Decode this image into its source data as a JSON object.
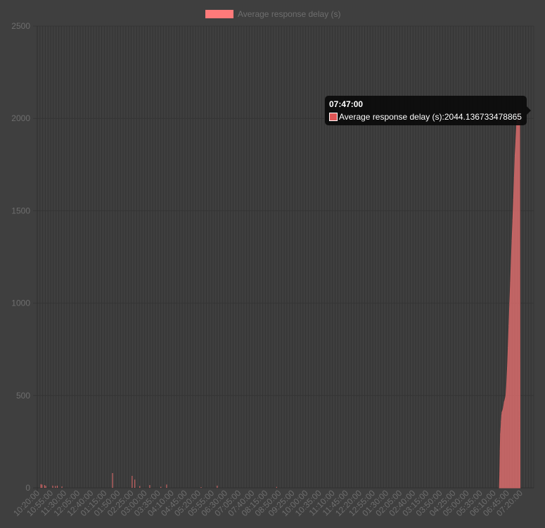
{
  "legend": {
    "label": "Average response delay (s)",
    "color": "#ff7a7a"
  },
  "tooltip": {
    "title": "07:47:00",
    "series_label": "Average response delay (s): ",
    "value": "2044.136733478865",
    "swatch_color": "#e05555"
  },
  "chart_data": {
    "type": "area",
    "title": "",
    "xlabel": "",
    "ylabel": "",
    "ylim": [
      0,
      2500
    ],
    "yticks": [
      0,
      500,
      1000,
      1500,
      2000,
      2500
    ],
    "xtick_labels": [
      "10:20:00",
      "10:55:00",
      "11:30:00",
      "12:05:00",
      "12:40:00",
      "01:15:00",
      "01:50:00",
      "02:25:00",
      "03:00:00",
      "03:35:00",
      "04:10:00",
      "04:45:00",
      "05:20:00",
      "05:55:00",
      "06:30:00",
      "07:05:00",
      "07:40:00",
      "08:15:00",
      "08:50:00",
      "09:25:00",
      "10:00:00",
      "10:35:00",
      "11:10:00",
      "11:45:00",
      "12:20:00",
      "12:55:00",
      "01:30:00",
      "02:05:00",
      "02:40:00",
      "03:15:00",
      "03:50:00",
      "04:25:00",
      "05:00:00",
      "05:35:00",
      "06:10:00",
      "06:45:00",
      "07:20:00"
    ],
    "grid": true,
    "legend_position": "top",
    "series": [
      {
        "name": "Average response delay (s)",
        "color": "#ff7a7a",
        "spikes": [
          {
            "x": "10:22:00",
            "y": 20
          },
          {
            "x": "10:25:00",
            "y": 18
          },
          {
            "x": "10:32:00",
            "y": 15
          },
          {
            "x": "10:35:00",
            "y": 10
          },
          {
            "x": "10:53:00",
            "y": 12
          },
          {
            "x": "11:00:00",
            "y": 10
          },
          {
            "x": "11:05:00",
            "y": 12
          },
          {
            "x": "11:17:00",
            "y": 8
          },
          {
            "x": "12:50:00",
            "y": 10
          },
          {
            "x": "01:29:00",
            "y": 80
          },
          {
            "x": "02:20:00",
            "y": 65
          },
          {
            "x": "02:27:00",
            "y": 45
          },
          {
            "x": "02:40:00",
            "y": 10
          },
          {
            "x": "03:06:00",
            "y": 15
          },
          {
            "x": "03:50:00",
            "y": 18
          },
          {
            "x": "06:02:00",
            "y": 12
          },
          {
            "x": "08:37:00",
            "y": 5
          },
          {
            "x": "03:35:00",
            "y": 6
          },
          {
            "x": "05:20:00",
            "y": 4
          }
        ],
        "ramp": [
          {
            "x": "06:18:00",
            "y": 0
          },
          {
            "x": "06:19:00",
            "y": 80
          },
          {
            "x": "06:20:00",
            "y": 200
          },
          {
            "x": "06:21:00",
            "y": 290
          },
          {
            "x": "06:22:00",
            "y": 320
          },
          {
            "x": "06:23:00",
            "y": 360
          },
          {
            "x": "06:24:00",
            "y": 390
          },
          {
            "x": "06:25:00",
            "y": 410
          },
          {
            "x": "06:27:00",
            "y": 420
          },
          {
            "x": "06:29:00",
            "y": 440
          },
          {
            "x": "06:31:00",
            "y": 465
          },
          {
            "x": "06:33:00",
            "y": 480
          },
          {
            "x": "06:35:00",
            "y": 500
          },
          {
            "x": "06:37:00",
            "y": 560
          },
          {
            "x": "06:39:00",
            "y": 650
          },
          {
            "x": "06:41:00",
            "y": 760
          },
          {
            "x": "06:43:00",
            "y": 880
          },
          {
            "x": "06:45:00",
            "y": 1000
          },
          {
            "x": "06:47:00",
            "y": 1110
          },
          {
            "x": "06:49:00",
            "y": 1230
          },
          {
            "x": "06:51:00",
            "y": 1340
          },
          {
            "x": "06:53:00",
            "y": 1450
          },
          {
            "x": "06:55:00",
            "y": 1560
          },
          {
            "x": "06:57:00",
            "y": 1680
          },
          {
            "x": "06:59:00",
            "y": 1800
          },
          {
            "x": "07:01:00",
            "y": 1880
          },
          {
            "x": "07:03:00",
            "y": 1960
          },
          {
            "x": "07:05:00",
            "y": 2000
          },
          {
            "x": "07:07:00",
            "y": 2044.136733478865
          },
          {
            "x": "07:09:00",
            "y": 2030
          },
          {
            "x": "07:11:00",
            "y": 1980
          },
          {
            "x": "07:12:00",
            "y": 0
          }
        ]
      }
    ]
  }
}
